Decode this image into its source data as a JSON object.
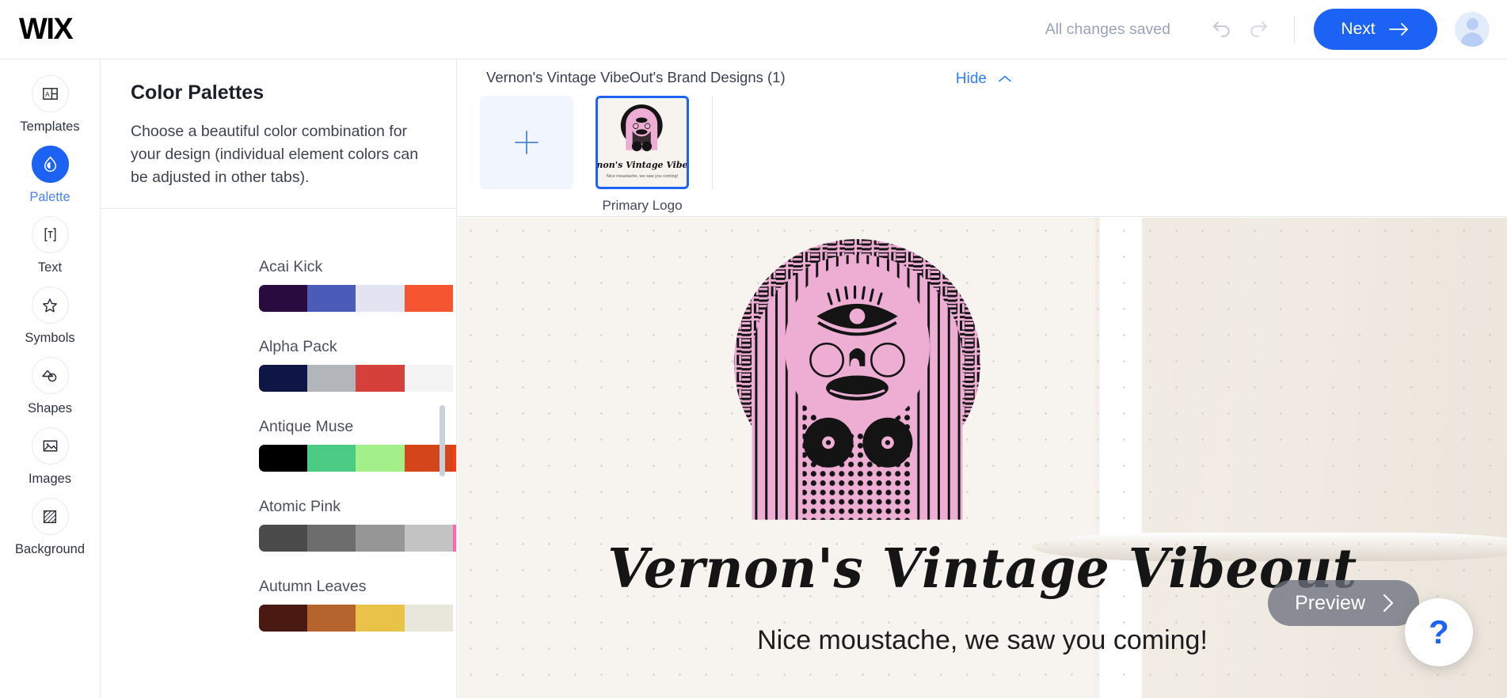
{
  "app": {
    "brand": "WIX"
  },
  "topbar": {
    "save_status": "All changes saved",
    "undo_icon": "undo-icon",
    "redo_icon": "redo-icon",
    "next_label": "Next",
    "next_color": "#1b62f5"
  },
  "rail": {
    "items": [
      {
        "label": "Templates",
        "icon": "templates-icon",
        "active": false
      },
      {
        "label": "Palette",
        "icon": "droplet-icon",
        "active": true
      },
      {
        "label": "Text",
        "icon": "text-icon",
        "active": false
      },
      {
        "label": "Symbols",
        "icon": "star-icon",
        "active": false
      },
      {
        "label": "Shapes",
        "icon": "shapes-icon",
        "active": false
      },
      {
        "label": "Images",
        "icon": "image-icon",
        "active": false
      },
      {
        "label": "Background",
        "icon": "background-icon",
        "active": false
      }
    ]
  },
  "panel": {
    "title": "Color Palettes",
    "description": "Choose a beautiful color combination for your design (individual element colors can be adjusted in other tabs).",
    "palettes": [
      {
        "name": "Acai Kick",
        "colors": [
          "#2a0b3f",
          "#4a5cb8",
          "#e2e5f1",
          "#f55531",
          "#ffffff"
        ]
      },
      {
        "name": "Alpha Pack",
        "colors": [
          "#0d1645",
          "#b2b5ba",
          "#d6403a",
          "#f4f4f4",
          "#ffffff"
        ]
      },
      {
        "name": "Antique Muse",
        "colors": [
          "#000000",
          "#4ccb85",
          "#a3ef8a",
          "#d4461a",
          "#fa3c10"
        ]
      },
      {
        "name": "Atomic Pink",
        "colors": [
          "#4b4b4b",
          "#6d6d6d",
          "#969696",
          "#c3c3c3",
          "#fb65b2"
        ]
      },
      {
        "name": "Autumn Leaves",
        "colors": [
          "#4a1a12",
          "#b5642d",
          "#e8c348",
          "#e8e7dc",
          "#ffffff"
        ]
      }
    ]
  },
  "designs": {
    "title": "Vernon's Vintage VibeOut's Brand Designs (1)",
    "hide_label": "Hide",
    "add_icon": "plus-icon",
    "collapse_icon": "chevron-up-icon",
    "items": [
      {
        "label": "Primary Logo",
        "selected": true
      }
    ]
  },
  "canvas": {
    "logo_name": "Vernon's Vintage Vibeout",
    "tagline": "Nice moustache, we saw you coming!",
    "preview_label": "Preview",
    "preview_icon": "chevron-right-icon",
    "help_label": "?",
    "background": "#f7f3ef",
    "art_pink": "#eeaed4",
    "art_ink": "#111111"
  }
}
